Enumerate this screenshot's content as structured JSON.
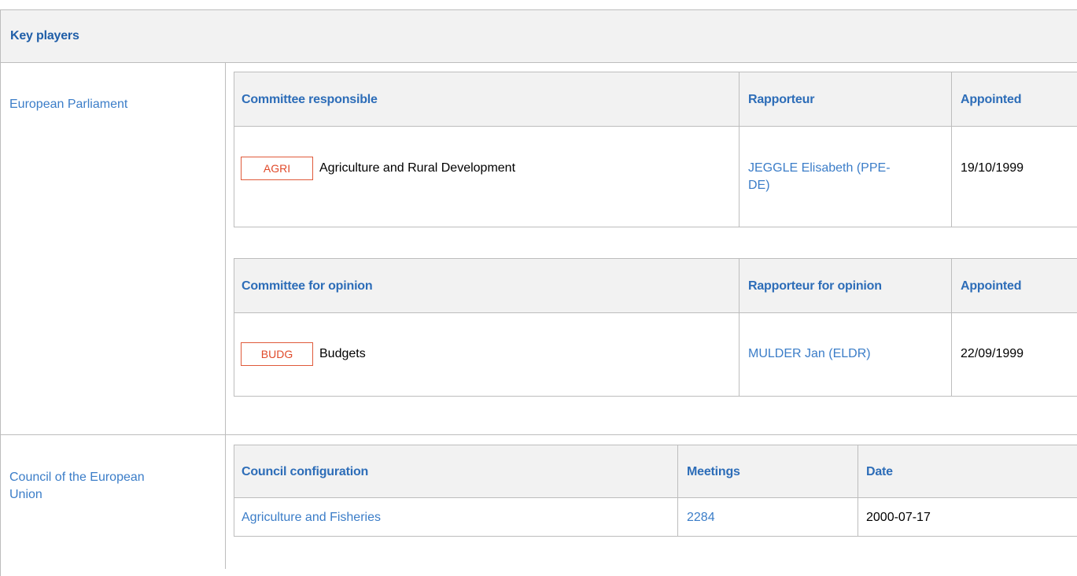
{
  "section": {
    "title": "Key players"
  },
  "parliament": {
    "label": "European Parliament",
    "responsible": {
      "headers": {
        "committee": "Committee responsible",
        "rapporteur": "Rapporteur",
        "appointed": "Appointed"
      },
      "row": {
        "code": "AGRI",
        "name": "Agriculture and Rural Development",
        "rapporteur_line1": "JEGGLE Elisabeth (PPE-",
        "rapporteur_line2": "DE)",
        "appointed": "19/10/1999"
      }
    },
    "opinion": {
      "headers": {
        "committee": "Committee for opinion",
        "rapporteur": "Rapporteur for opinion",
        "appointed": "Appointed"
      },
      "row": {
        "code": "BUDG",
        "name": "Budgets",
        "rapporteur": "MULDER Jan (ELDR)",
        "appointed": "22/09/1999"
      }
    }
  },
  "council": {
    "label_line1": "Council of the European",
    "label_line2": "Union",
    "headers": {
      "configuration": "Council configuration",
      "meetings": "Meetings",
      "date": "Date"
    },
    "row": {
      "configuration": "Agriculture and Fisheries",
      "meetings": "2284",
      "date": "2000-07-17"
    }
  },
  "colors": {
    "link": "#3b7dc8",
    "header_text": "#2d6db8",
    "badge": "#e04a2a",
    "header_bg": "#f2f2f2",
    "border": "#bdbdbd"
  }
}
